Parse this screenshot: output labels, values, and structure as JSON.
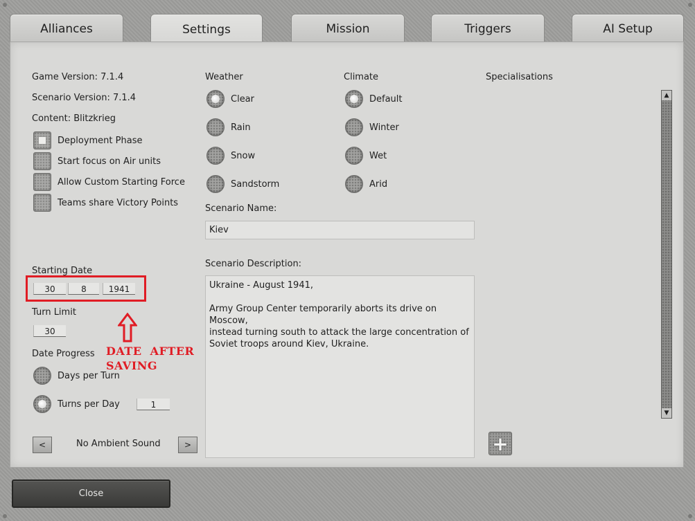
{
  "tabs": [
    {
      "label": "Alliances",
      "active": false
    },
    {
      "label": "Settings",
      "active": true
    },
    {
      "label": "Mission",
      "active": false
    },
    {
      "label": "Triggers",
      "active": false
    },
    {
      "label": "AI Setup",
      "active": false
    }
  ],
  "info": {
    "game_version": "Game Version: 7.1.4",
    "scenario_version": "Scenario Version: 7.1.4",
    "content": "Content: Blitzkrieg"
  },
  "checkboxes": [
    {
      "label": "Deployment Phase",
      "checked": true
    },
    {
      "label": "Start focus on Air units",
      "checked": false
    },
    {
      "label": "Allow Custom Starting Force",
      "checked": false
    },
    {
      "label": "Teams share Victory Points",
      "checked": false
    }
  ],
  "starting_date": {
    "label": "Starting Date",
    "day": "30",
    "month": "8",
    "year": "1941"
  },
  "turn_limit": {
    "label": "Turn Limit",
    "value": "30"
  },
  "date_progress": {
    "label": "Date Progress",
    "options": [
      {
        "label": "Days per Turn",
        "selected": false
      },
      {
        "label": "Turns per Day",
        "selected": true
      }
    ],
    "turns_per_day_value": "1"
  },
  "ambient": {
    "prev": "<",
    "label": "No Ambient Sound",
    "next": ">"
  },
  "weather": {
    "label": "Weather",
    "options": [
      {
        "label": "Clear",
        "selected": true
      },
      {
        "label": "Rain",
        "selected": false
      },
      {
        "label": "Snow",
        "selected": false
      },
      {
        "label": "Sandstorm",
        "selected": false
      }
    ]
  },
  "climate": {
    "label": "Climate",
    "options": [
      {
        "label": "Default",
        "selected": true
      },
      {
        "label": "Winter",
        "selected": false
      },
      {
        "label": "Wet",
        "selected": false
      },
      {
        "label": "Arid",
        "selected": false
      }
    ]
  },
  "scenario_name": {
    "label": "Scenario Name:",
    "value": "Kiev"
  },
  "scenario_description": {
    "label": "Scenario Description:",
    "value": "Ukraine - August 1941,\n\nArmy Group Center temporarily aborts its drive on Moscow,\ninstead turning south to attack the large concentration of\nSoviet troops around Kiev, Ukraine."
  },
  "specialisations": {
    "label": "Specialisations",
    "add_icon": "plus-icon"
  },
  "close_label": "Close",
  "annotation": {
    "text": "DATE  AFTER\nSAVING",
    "color": "#e01c24"
  }
}
